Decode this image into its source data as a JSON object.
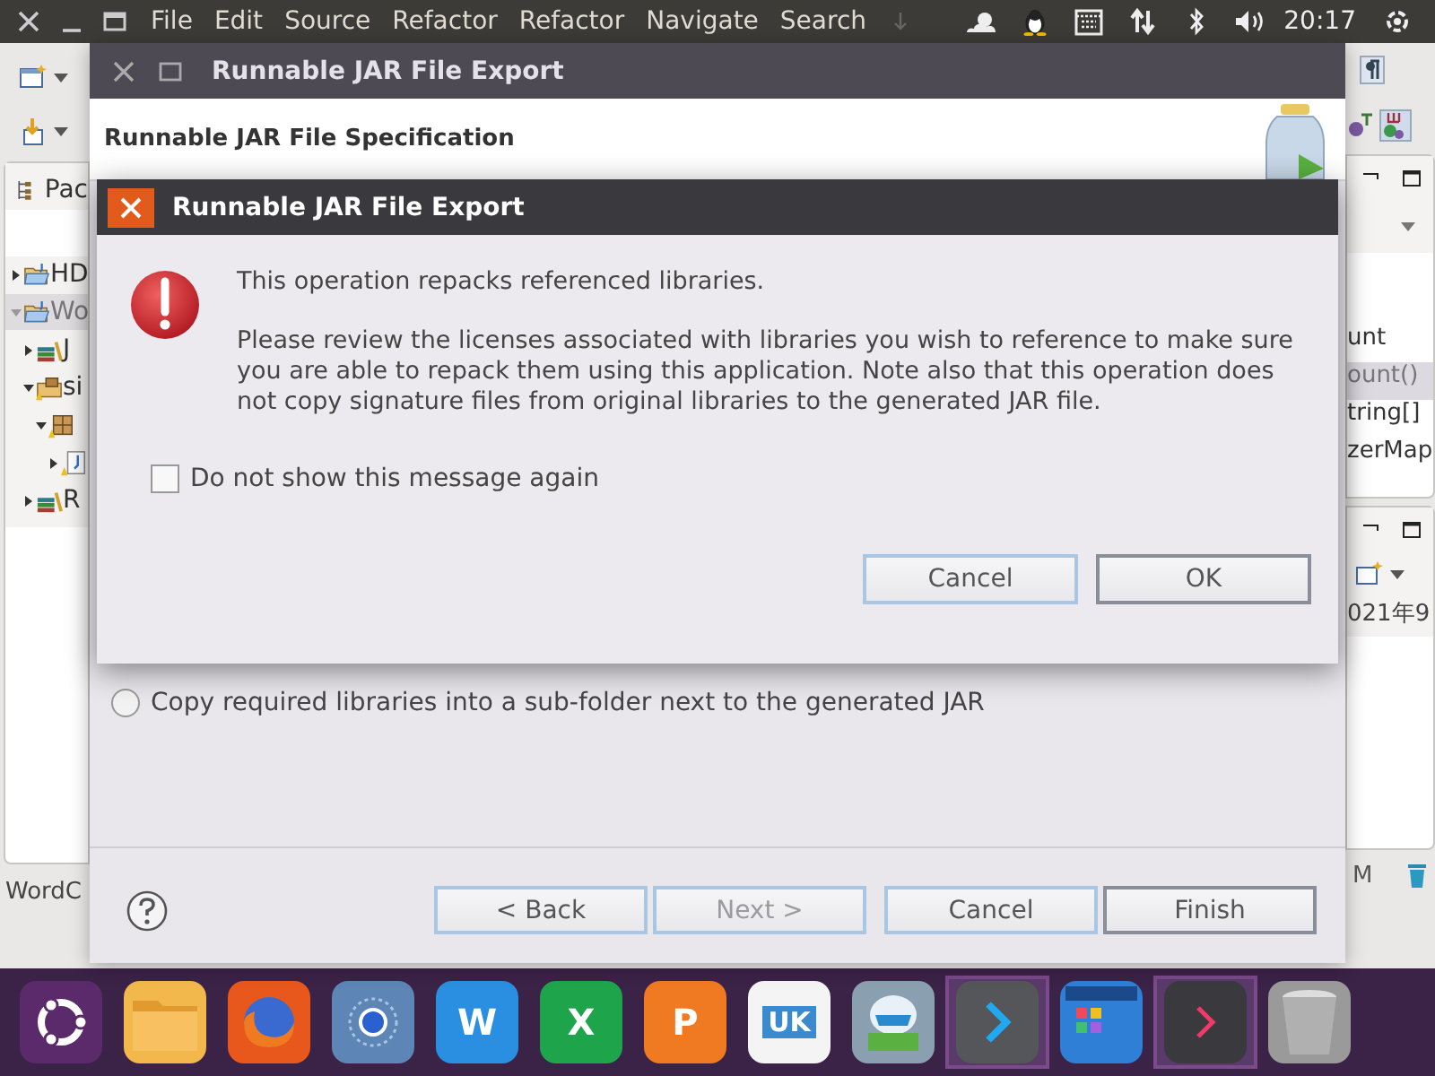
{
  "top_bar": {
    "menus": [
      "File",
      "Edit",
      "Source",
      "Refactor",
      "Refactor",
      "Navigate",
      "Search"
    ],
    "clock": "20:17"
  },
  "package_explorer": {
    "tab": "Pac",
    "items": [
      {
        "label": "HD",
        "kind": "project",
        "expanded": false,
        "selected": false
      },
      {
        "label": "Wo",
        "kind": "project",
        "expanded": true,
        "selected": true,
        "children": [
          {
            "label": "J",
            "kind": "library",
            "expanded": false,
            "selected": false
          },
          {
            "label": "si",
            "kind": "source-folder",
            "expanded": true,
            "selected": false,
            "children": [
              {
                "kind": "package",
                "expanded": true,
                "selected": false,
                "children": [
                  {
                    "kind": "file",
                    "expanded": false,
                    "selected": false
                  }
                ]
              }
            ]
          },
          {
            "label": "R",
            "kind": "library",
            "expanded": false,
            "selected": false
          }
        ]
      }
    ]
  },
  "status_left": "WordC",
  "outline": [
    {
      "label": "unt",
      "selected": false
    },
    {
      "label": "ount()",
      "selected": true
    },
    {
      "label": "tring[]",
      "selected": false
    },
    {
      "label": "zerMap",
      "selected": false
    }
  ],
  "tasks_text": "021年9",
  "status_right": "M",
  "wizard": {
    "title": "Runnable JAR File Export",
    "header": "Runnable JAR File Specification",
    "options": [
      {
        "label": "Copy required libraries into a sub-folder next to the generated JAR",
        "selected": false
      }
    ],
    "buttons": [
      {
        "label": "< Back",
        "disabled": false,
        "default": false
      },
      {
        "label": "Next >",
        "disabled": true,
        "default": false
      },
      {
        "label": "Cancel",
        "disabled": false,
        "default": false
      },
      {
        "label": "Finish",
        "disabled": false,
        "default": true
      }
    ]
  },
  "alert": {
    "title": "Runnable JAR File Export",
    "messages": [
      "This operation repacks referenced libraries.",
      "Please review the licenses associated with libraries you wish to reference to make sure you are able to repack them using this application. Note also that this operation does not copy signature files from original libraries to the generated JAR file."
    ],
    "checkbox": {
      "label": "Do not show this message again",
      "checked": false
    },
    "buttons": [
      {
        "label": "Cancel",
        "default": false
      },
      {
        "label": "OK",
        "default": true
      }
    ]
  },
  "dock": [
    {
      "kind": "ubuntu",
      "highlighted": false
    },
    {
      "kind": "folder",
      "highlighted": false
    },
    {
      "kind": "firefox",
      "highlighted": false
    },
    {
      "kind": "browser",
      "highlighted": false
    },
    {
      "kind": "word",
      "glyph": "W",
      "highlighted": false
    },
    {
      "kind": "excel",
      "glyph": "X",
      "highlighted": false
    },
    {
      "kind": "ppt",
      "glyph": "P",
      "highlighted": false
    },
    {
      "kind": "store",
      "glyph": "UK",
      "highlighted": false
    },
    {
      "kind": "robot",
      "highlighted": false
    },
    {
      "kind": "code",
      "highlighted": true
    },
    {
      "kind": "apps",
      "highlighted": false
    },
    {
      "kind": "terminal",
      "highlighted": true
    },
    {
      "kind": "trash",
      "highlighted": false
    }
  ]
}
